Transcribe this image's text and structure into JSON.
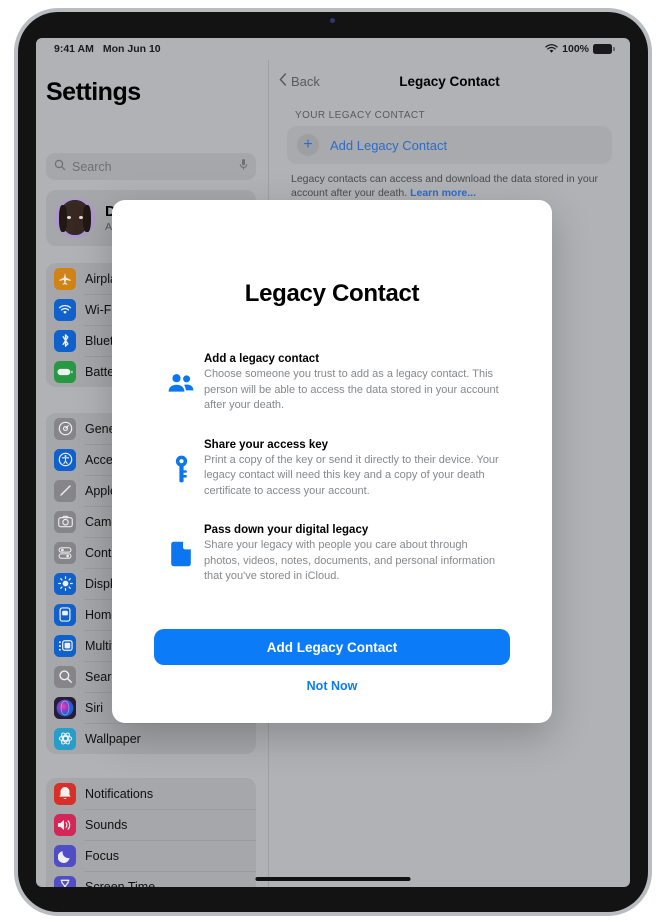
{
  "status_bar": {
    "time": "9:41 AM",
    "date": "Mon Jun 10",
    "battery_percent": "100%",
    "wifi_icon": "wifi-icon",
    "battery_icon": "battery-full-icon"
  },
  "sidebar": {
    "title": "Settings",
    "search": {
      "placeholder": "Search",
      "icon": "search-icon",
      "mic_icon": "microphone-icon"
    },
    "profile": {
      "name": "Danny Rico",
      "subtitle": "Apple Account, iCloud",
      "avatar": "memoji-avatar"
    },
    "groups": [
      {
        "items": [
          {
            "label": "Airplane Mode",
            "icon": "airplane-icon",
            "color": "#e08c18"
          },
          {
            "label": "Wi-Fi",
            "icon": "wifi-icon",
            "color": "#1168d9"
          },
          {
            "label": "Bluetooth",
            "icon": "bluetooth-icon",
            "color": "#1168d9"
          },
          {
            "label": "Battery",
            "icon": "battery-icon",
            "color": "#2aa349"
          }
        ]
      },
      {
        "items": [
          {
            "label": "General",
            "icon": "gear-icon",
            "color": "#8e8e93"
          },
          {
            "label": "Accessibility",
            "icon": "accessibility-icon",
            "color": "#1168d9"
          },
          {
            "label": "Apple Pencil",
            "icon": "pencil-icon",
            "color": "#8e8e93"
          },
          {
            "label": "Camera",
            "icon": "camera-icon",
            "color": "#8e8e93"
          },
          {
            "label": "Control Center",
            "icon": "control-center-icon",
            "color": "#8e8e93"
          },
          {
            "label": "Display & Brightness",
            "icon": "brightness-icon",
            "color": "#1168d9"
          },
          {
            "label": "Home Screen & App Library",
            "icon": "home-screen-icon",
            "color": "#1168d9"
          },
          {
            "label": "Multitasking & Gestures",
            "icon": "multitasking-icon",
            "color": "#1168d9"
          },
          {
            "label": "Search",
            "icon": "search-icon",
            "color": "#8e8e93"
          },
          {
            "label": "Siri",
            "icon": "siri-icon",
            "color": "#2b1f3a"
          },
          {
            "label": "Wallpaper",
            "icon": "wallpaper-icon",
            "color": "#2aa7d6"
          }
        ]
      },
      {
        "items": [
          {
            "label": "Notifications",
            "icon": "bell-icon",
            "color": "#e5342b"
          },
          {
            "label": "Sounds",
            "icon": "speaker-icon",
            "color": "#e12a5e"
          },
          {
            "label": "Focus",
            "icon": "moon-icon",
            "color": "#5653d4"
          },
          {
            "label": "Screen Time",
            "icon": "hourglass-icon",
            "color": "#5653d4"
          }
        ]
      }
    ]
  },
  "detail": {
    "back_label": "Back",
    "back_icon": "chevron-left-icon",
    "title": "Legacy Contact",
    "section_header": "YOUR LEGACY CONTACT",
    "add_row": {
      "label": "Add Legacy Contact",
      "icon": "plus-icon"
    },
    "footnote": "Legacy contacts can access and download the data stored in your account after your death.",
    "footnote_link": "Learn more..."
  },
  "modal": {
    "title": "Legacy Contact",
    "features": [
      {
        "icon": "people-icon",
        "title": "Add a legacy contact",
        "description": "Choose someone you trust to add as a legacy contact. This person will be able to access the data stored in your account after your death."
      },
      {
        "icon": "key-icon",
        "title": "Share your access key",
        "description": "Print a copy of the key or send it directly to their device. Your legacy contact will need this key and a copy of your death certificate to access your account."
      },
      {
        "icon": "document-icon",
        "title": "Pass down your digital legacy",
        "description": "Share your legacy with people you care about through photos, videos, notes, documents, and personal information that you've stored in iCloud."
      }
    ],
    "primary_button": "Add Legacy Contact",
    "secondary_button": "Not Now"
  },
  "colors": {
    "accent_blue": "#0b7bf7",
    "link_blue": "#2f73d8",
    "screen_bg": "#bcbec1",
    "card_bg": "#b0b2b5"
  }
}
